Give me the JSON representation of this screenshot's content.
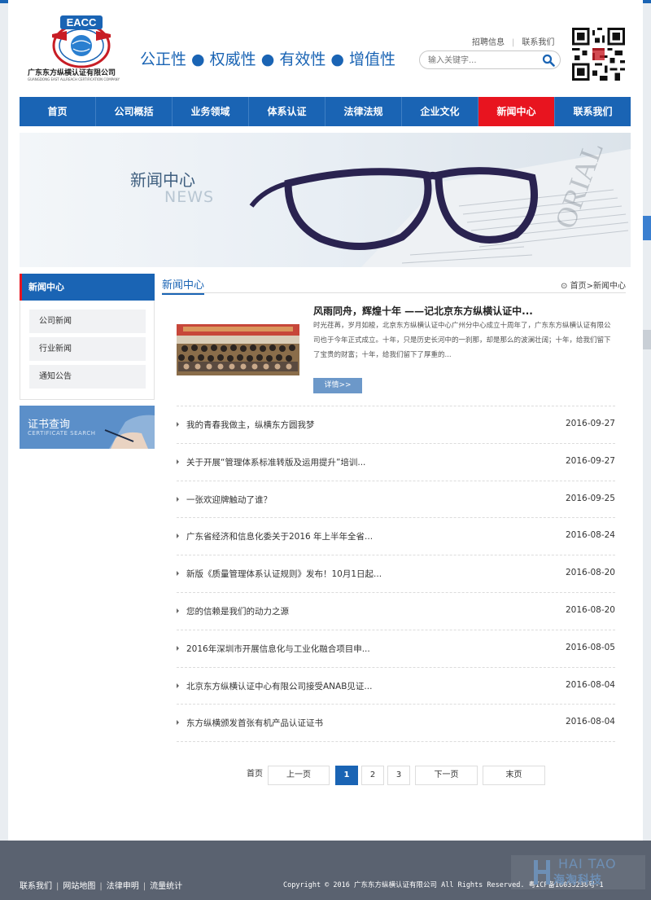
{
  "header": {
    "logo_name": "广东东方纵横认证有限公司",
    "logo_sub": "GUANGDONG EAST ALLREACH CERTIFICATION COMPANY",
    "logo_badge": "EACC",
    "slogan": "公正性 ● 权威性 ● 有效性 ● 增值性",
    "links": [
      "招聘信息",
      "联系我们"
    ],
    "search_placeholder": "输入关键字..."
  },
  "nav": [
    "首页",
    "公司概括",
    "业务领域",
    "体系认证",
    "法律法规",
    "企业文化",
    "新闻中心",
    "联系我们"
  ],
  "nav_active_index": 6,
  "banner": {
    "title": "新闻中心",
    "subtitle": "NEWS"
  },
  "sidebar": {
    "title": "新闻中心",
    "items": [
      "公司新闻",
      "行业新闻",
      "通知公告"
    ],
    "cert_title": "证书查询",
    "cert_sub": "CERTIFICATE SEARCH"
  },
  "main": {
    "title": "新闻中心",
    "breadcrumb": "首页>新闻中心",
    "featured": {
      "title": "风雨同舟，辉煌十年 ——记北京东方纵横认证中...",
      "desc": "时光荏苒，岁月如梭，北京东方纵横认证中心广州分中心成立十周年了，广东东方纵横认证有限公司也于今年正式成立。十年，只是历史长河中的一刹那，却是那么的波澜壮阔；十年，给我们留下了宝贵的财富；十年，给我们留下了厚重的...",
      "button": "详情>>"
    },
    "news": [
      {
        "title": "我的青春我做主，纵横东方圆我梦",
        "date": "2016-09-27"
      },
      {
        "title": "关于开展“管理体系标准转版及运用提升”培训...",
        "date": "2016-09-27"
      },
      {
        "title": "一张欢迎牌触动了谁？",
        "date": "2016-09-25"
      },
      {
        "title": "广东省经济和信息化委关于2016 年上半年全省...",
        "date": "2016-08-24"
      },
      {
        "title": "新版《质量管理体系认证规则》发布！10月1日起...",
        "date": "2016-08-20"
      },
      {
        "title": "您的信赖是我们的动力之源",
        "date": "2016-08-20"
      },
      {
        "title": "2016年深圳市开展信息化与工业化融合项目申...",
        "date": "2016-08-05"
      },
      {
        "title": "北京东方纵横认证中心有限公司接受ANAB见证...",
        "date": "2016-08-04"
      },
      {
        "title": "东方纵横颁发首张有机产品认证证书",
        "date": "2016-08-04"
      }
    ]
  },
  "pagination": {
    "first": "首页",
    "prev": "上一页",
    "pages": [
      "1",
      "2",
      "3"
    ],
    "current": "1",
    "next": "下一页",
    "last": "末页"
  },
  "footer": {
    "links": [
      "联系我们",
      "网站地图",
      "法律申明",
      "流量统计"
    ],
    "copyright": "Copyright © 2016 广东东方纵横认证有限公司 All Rights Reserved. 粤ICP备16033238号-1",
    "watermark_1": "HAI TAO",
    "watermark_2": "海淘科技"
  },
  "colors": {
    "brand_blue": "#1a64b4",
    "active_red": "#e8141f",
    "footer_bg": "#5a6270"
  }
}
